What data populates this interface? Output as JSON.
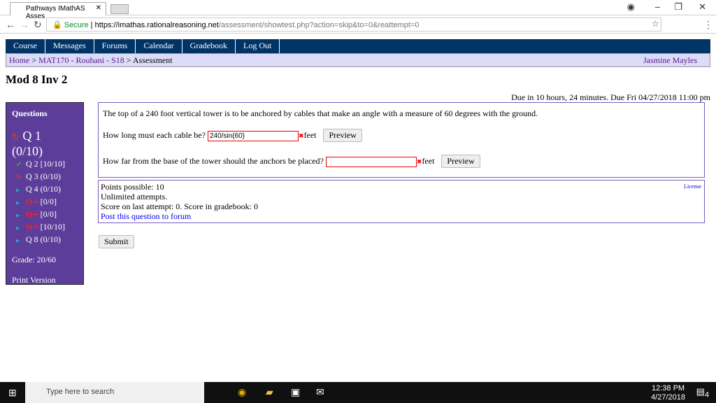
{
  "browser": {
    "tab_title": "Pathways IMathAS Asses",
    "url_secure": "Secure",
    "url_host": "https://imathas.rationalreasoning.net",
    "url_path": "/assessment/showtest.php?action=skip&to=0&reattempt=0"
  },
  "menu": [
    "Course",
    "Messages",
    "Forums",
    "Calendar",
    "Gradebook",
    "Log Out"
  ],
  "breadcrumb": {
    "home": "Home",
    "course": "MAT170 - Rouhani - S18",
    "current": "Assessment",
    "user": "Jasmine Mayles"
  },
  "title": "Mod 8 Inv 2",
  "due": "Due in 10 hours, 24 minutes. Due Fri 04/27/2018 11:00 pm",
  "sidebar": {
    "heading": "Questions",
    "current": {
      "label": "Q 1",
      "score": "(0/10)"
    },
    "items": [
      {
        "label": "Q 2",
        "score": "[10/10]",
        "icon": "check-icon",
        "color": "#3cb043"
      },
      {
        "label": "Q 3",
        "score": "(0/10)",
        "icon": "retry-icon",
        "color": "#e04020"
      },
      {
        "label": "Q 4",
        "score": "(0/10)",
        "icon": "arrow-icon",
        "color": "#2aa0d0"
      },
      {
        "label": "Q 5",
        "score": "[0/0]",
        "icon": "arrow-icon",
        "struck": true
      },
      {
        "label": "Q 6",
        "score": "[0/0]",
        "icon": "arrow-icon",
        "struck": true
      },
      {
        "label": "Q 7",
        "score": "[10/10]",
        "icon": "arrow-icon",
        "struck": true
      },
      {
        "label": "Q 8",
        "score": "(0/10)",
        "icon": "arrow-icon"
      }
    ],
    "grade": "Grade: 20/60",
    "print": "Print Version"
  },
  "question": {
    "text": "The top of a 240 foot vertical tower is to be anchored by cables that make an angle with a measure of 60 degrees with the ground.",
    "part1": {
      "prompt": "How long must each cable be?",
      "value": "240/sin(60)",
      "unit": "feet",
      "preview": "Preview"
    },
    "part2": {
      "prompt": "How far from the base of the tower should the anchors be placed?",
      "value": "",
      "unit": "feet",
      "preview": "Preview"
    }
  },
  "info": {
    "points": "Points possible: 10",
    "attempts": "Unlimited attempts.",
    "score": "Score on last attempt: 0. Score in gradebook: 0",
    "forum": "Post this question to forum",
    "license": "License"
  },
  "submit": "Submit",
  "taskbar": {
    "search": "Type here to search",
    "time": "12:38 PM",
    "date": "4/27/2018",
    "notifications": "4"
  }
}
